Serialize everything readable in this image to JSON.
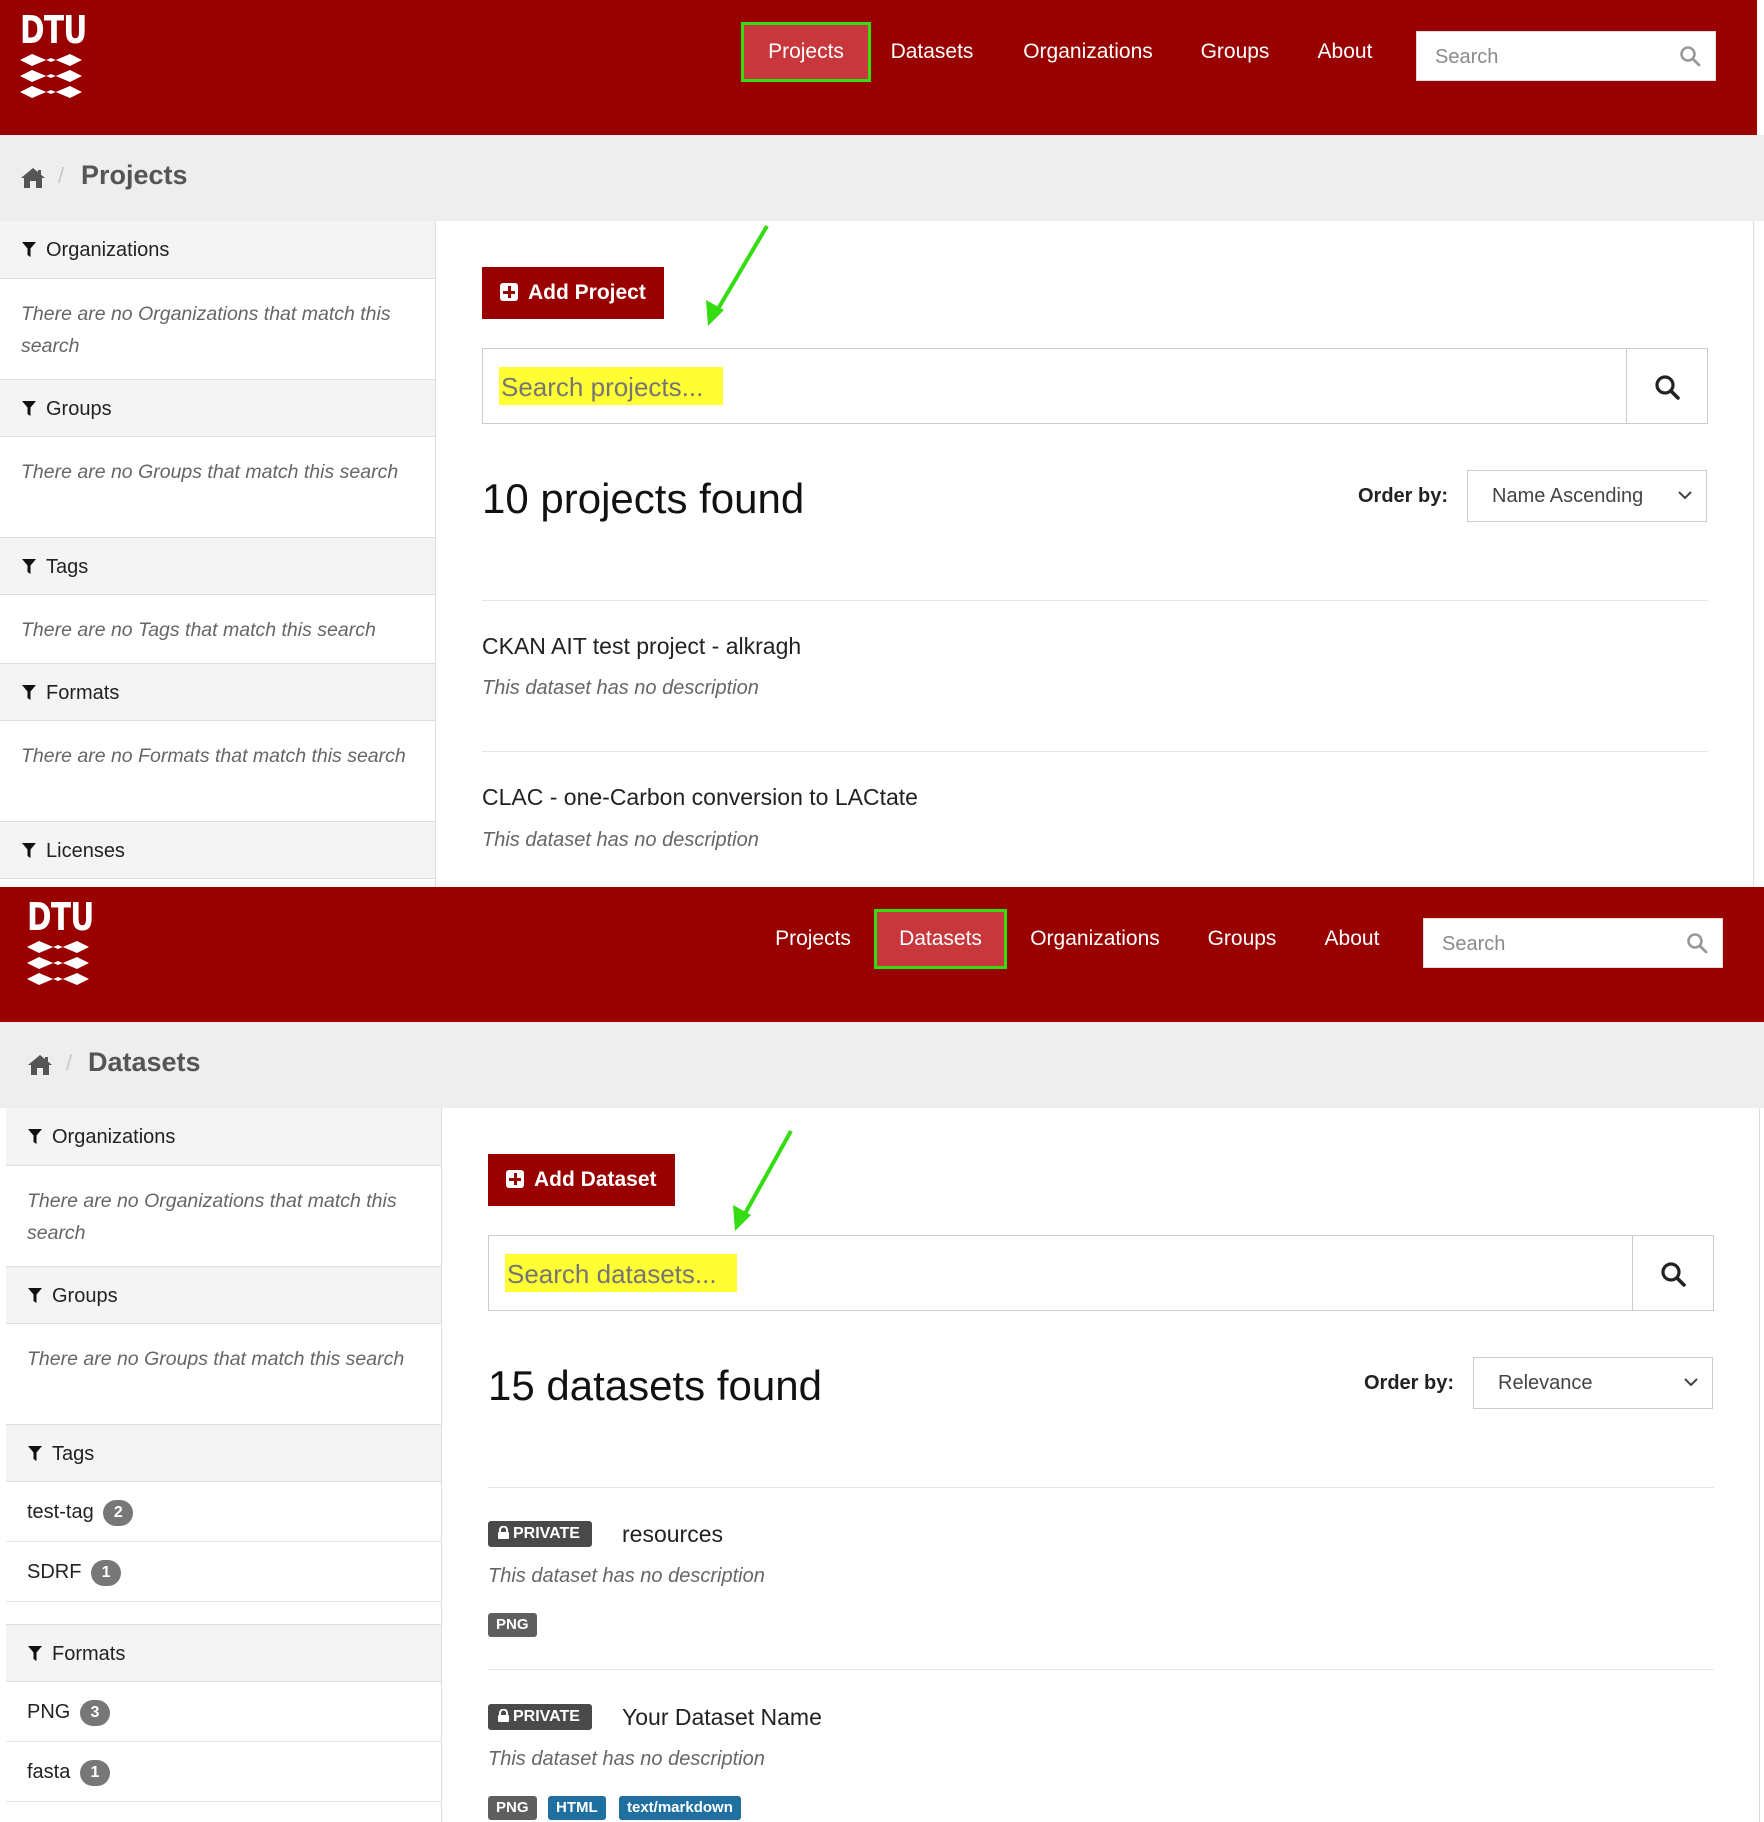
{
  "colors": {
    "brand": "#990000",
    "active_nav": "#c7373c",
    "highlight_box": "#33dd11",
    "search_highlight": "#ffff33",
    "arrow": "#33dd11"
  },
  "panel1": {
    "logo": "DTU",
    "nav": [
      "Projects",
      "Datasets",
      "Organizations",
      "Groups",
      "About"
    ],
    "active_nav": "Projects",
    "search_placeholder": "Search",
    "breadcrumb": {
      "home_icon": "home-icon",
      "title": "Projects"
    },
    "facets": [
      {
        "label": "Organizations",
        "empty": "There are no Organizations that match this search"
      },
      {
        "label": "Groups",
        "empty": "There are no Groups that match this search"
      },
      {
        "label": "Tags",
        "empty": "There are no Tags that match this search"
      },
      {
        "label": "Formats",
        "empty": "There are no Formats that match this search"
      },
      {
        "label": "Licenses"
      }
    ],
    "add_button": "Add Project",
    "search_placeholder_main": "Search projects...",
    "found": "10 projects found",
    "order_label": "Order by:",
    "order_value": "Name Ascending",
    "items": [
      {
        "title": "CKAN AIT test project - alkragh",
        "desc": "This dataset has no description"
      },
      {
        "title": "CLAC - one-Carbon conversion to LACtate",
        "desc": "This dataset has no description"
      }
    ]
  },
  "panel2": {
    "logo": "DTU",
    "nav": [
      "Projects",
      "Datasets",
      "Organizations",
      "Groups",
      "About"
    ],
    "active_nav": "Datasets",
    "search_placeholder": "Search",
    "breadcrumb": {
      "home_icon": "home-icon",
      "title": "Datasets"
    },
    "facets": [
      {
        "label": "Organizations",
        "empty": "There are no Organizations that match this search"
      },
      {
        "label": "Groups",
        "empty": "There are no Groups that match this search"
      },
      {
        "label": "Tags",
        "items": [
          {
            "name": "test-tag",
            "count": "2"
          },
          {
            "name": "SDRF",
            "count": "1"
          }
        ]
      },
      {
        "label": "Formats",
        "items": [
          {
            "name": "PNG",
            "count": "3"
          },
          {
            "name": "fasta",
            "count": "1"
          }
        ]
      }
    ],
    "add_button": "Add Dataset",
    "search_placeholder_main": "Search datasets...",
    "found": "15 datasets found",
    "order_label": "Order by:",
    "order_value": "Relevance",
    "items": [
      {
        "private": "PRIVATE",
        "title": "resources",
        "desc": "This dataset has no description",
        "formats": [
          "PNG"
        ]
      },
      {
        "private": "PRIVATE",
        "title": "Your Dataset Name",
        "desc": "This dataset has no description",
        "formats": [
          "PNG",
          "HTML",
          "text/markdown"
        ]
      }
    ]
  }
}
